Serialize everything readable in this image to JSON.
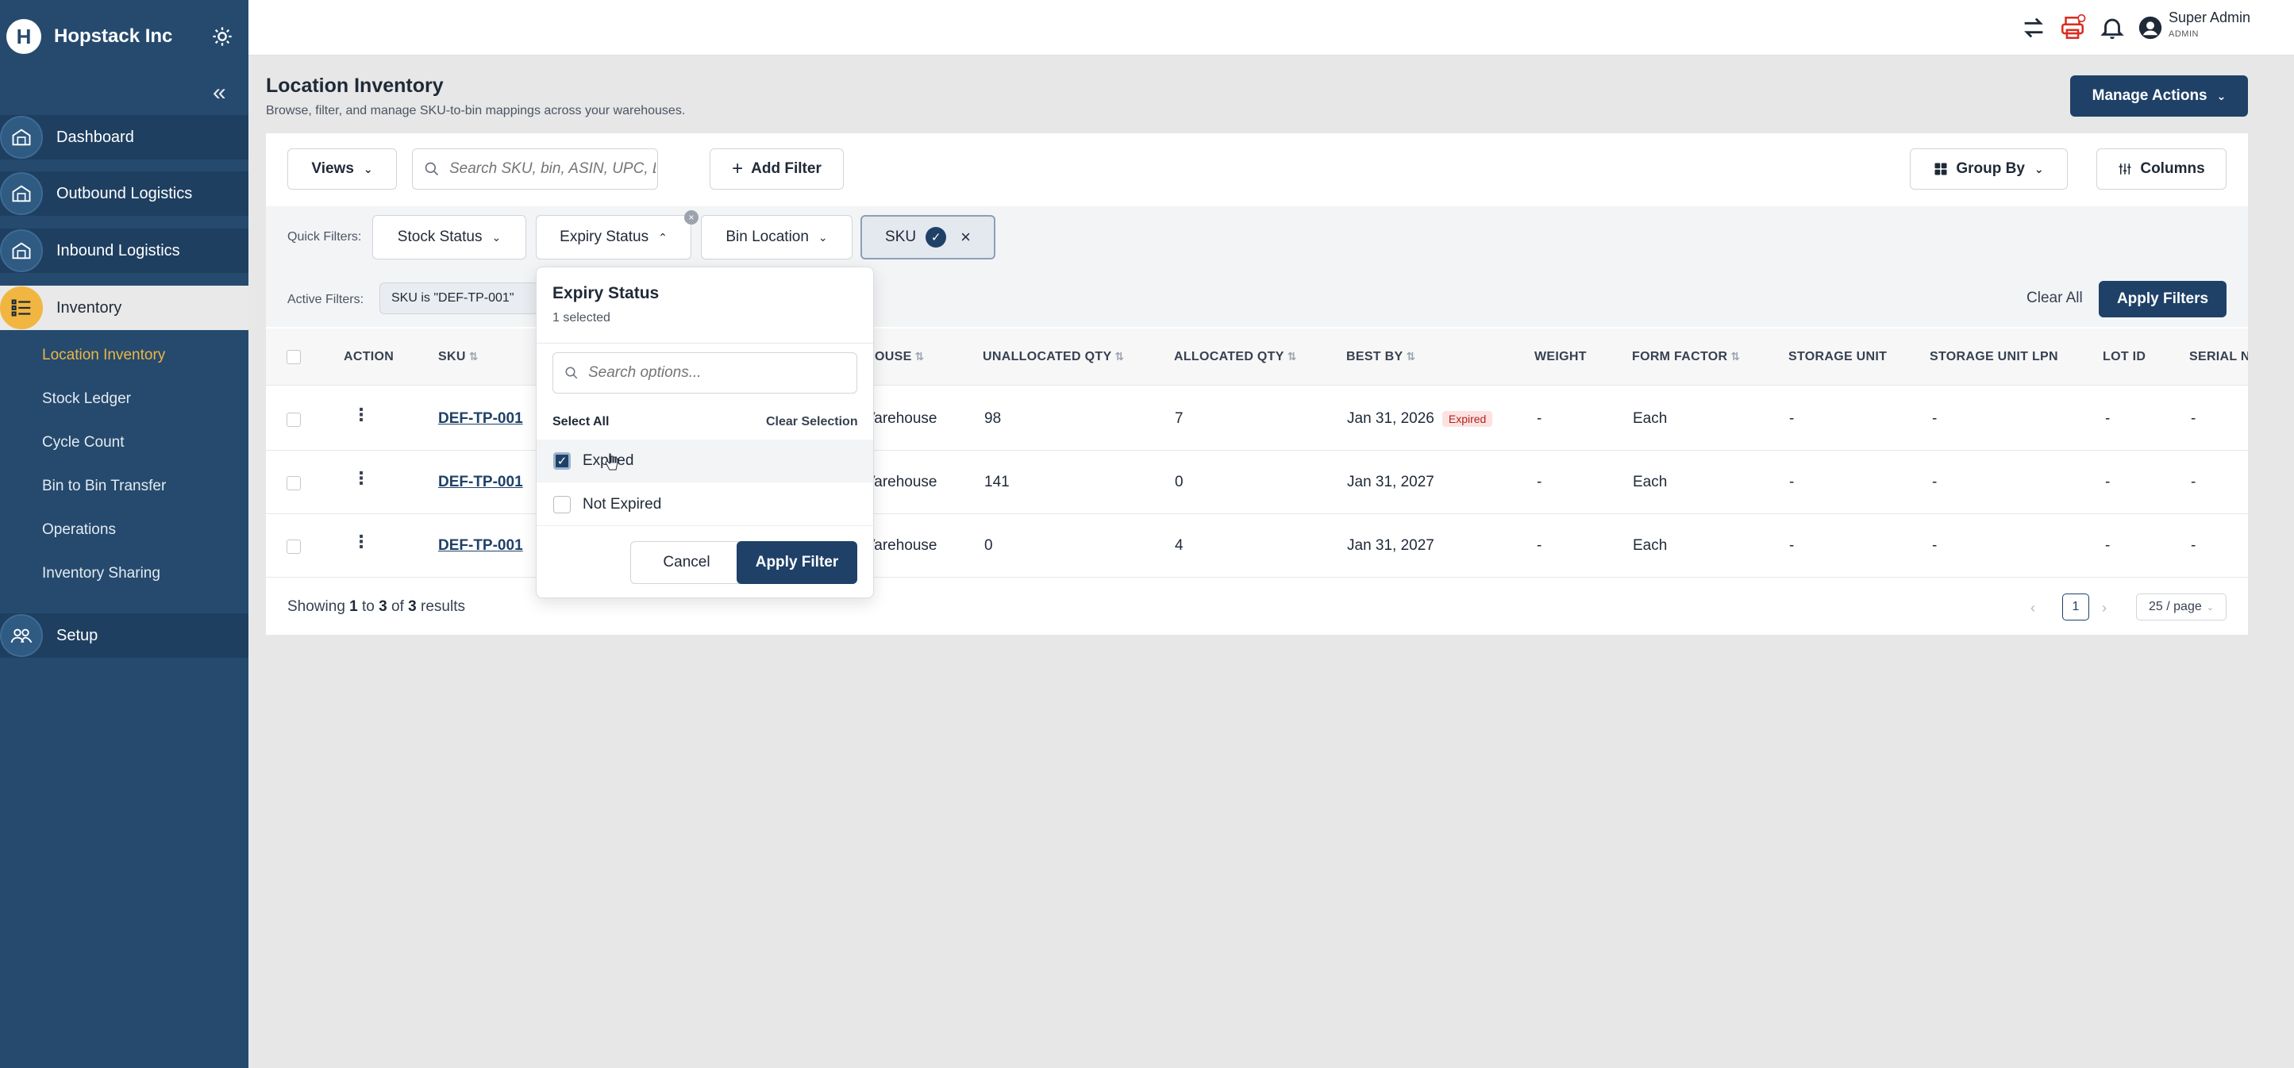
{
  "brand": {
    "name": "Hopstack Inc",
    "logo_letter": "H"
  },
  "sidebar": {
    "items": [
      {
        "label": "Dashboard",
        "icon": "warehouse-icon"
      },
      {
        "label": "Outbound Logistics",
        "icon": "warehouse-icon"
      },
      {
        "label": "Inbound Logistics",
        "icon": "warehouse-icon"
      },
      {
        "label": "Inventory",
        "icon": "list-icon"
      },
      {
        "label": "Setup",
        "icon": "people-icon"
      }
    ],
    "sub_items": [
      {
        "label": "Location Inventory"
      },
      {
        "label": "Stock Ledger"
      },
      {
        "label": "Cycle Count"
      },
      {
        "label": "Bin to Bin Transfer"
      },
      {
        "label": "Operations"
      },
      {
        "label": "Inventory Sharing"
      }
    ]
  },
  "topbar": {
    "user_name": "Super Admin",
    "user_role": "ADMIN"
  },
  "header": {
    "title": "Location Inventory",
    "subtitle": "Browse, filter, and manage SKU-to-bin mappings across your warehouses.",
    "manage_actions": "Manage Actions"
  },
  "toolbar": {
    "views": "Views",
    "search_placeholder": "Search SKU, bin, ASIN, UPC, LF",
    "add_filter": "Add Filter",
    "group_by": "Group By",
    "columns": "Columns"
  },
  "quick_filters": {
    "label": "Quick Filters:",
    "stock_status": "Stock Status",
    "expiry_status": "Expiry Status",
    "bin_location": "Bin Location",
    "sku": "SKU"
  },
  "active_filters": {
    "label": "Active Filters:",
    "chip": "SKU is \"DEF-TP-001\"",
    "clear_all": "Clear All",
    "apply": "Apply Filters"
  },
  "table": {
    "headers": {
      "action": "ACTION",
      "sku": "SKU",
      "warehouse": "OUSE",
      "unallocated": "UNALLOCATED QTY",
      "allocated": "ALLOCATED QTY",
      "best_by": "BEST BY",
      "weight": "WEIGHT",
      "form_factor": "FORM FACTOR",
      "storage_unit": "STORAGE UNIT",
      "storage_unit_lpn": "STORAGE UNIT LPN",
      "lot_id": "LOT ID",
      "serial": "SERIAL N"
    },
    "rows": [
      {
        "sku": "DEF-TP-001",
        "warehouse": "Varehouse",
        "unallocated": "98",
        "allocated": "7",
        "best_by": "Jan 31, 2026",
        "badge": "Expired",
        "weight": "-",
        "form_factor": "Each",
        "storage_unit": "-",
        "storage_unit_lpn": "-",
        "lot_id": "-",
        "serial": "-"
      },
      {
        "sku": "DEF-TP-001",
        "warehouse": "Varehouse",
        "unallocated": "141",
        "allocated": "0",
        "best_by": "Jan 31, 2027",
        "badge": "",
        "weight": "-",
        "form_factor": "Each",
        "storage_unit": "-",
        "storage_unit_lpn": "-",
        "lot_id": "-",
        "serial": "-"
      },
      {
        "sku": "DEF-TP-001",
        "warehouse": "Varehouse",
        "unallocated": "0",
        "allocated": "4",
        "best_by": "Jan 31, 2027",
        "badge": "",
        "weight": "-",
        "form_factor": "Each",
        "storage_unit": "-",
        "storage_unit_lpn": "-",
        "lot_id": "-",
        "serial": "-"
      }
    ]
  },
  "pagination": {
    "showing": "Showing",
    "from": "1",
    "to_word": "to",
    "to": "3",
    "of_word": "of",
    "total": "3",
    "results_word": "results",
    "page": "1",
    "page_size": "25 / page"
  },
  "dropdown": {
    "title": "Expiry Status",
    "count": "1 selected",
    "search_placeholder": "Search options...",
    "select_all": "Select All",
    "clear_selection": "Clear Selection",
    "options": [
      {
        "label": "Expired",
        "checked": true
      },
      {
        "label": "Not Expired",
        "checked": false
      }
    ],
    "cancel": "Cancel",
    "apply": "Apply Filter"
  },
  "colors": {
    "sidebar": "#254a6e",
    "primary": "#1f4168",
    "accent": "#f0b641",
    "expired_badge": "#fde2e2"
  }
}
